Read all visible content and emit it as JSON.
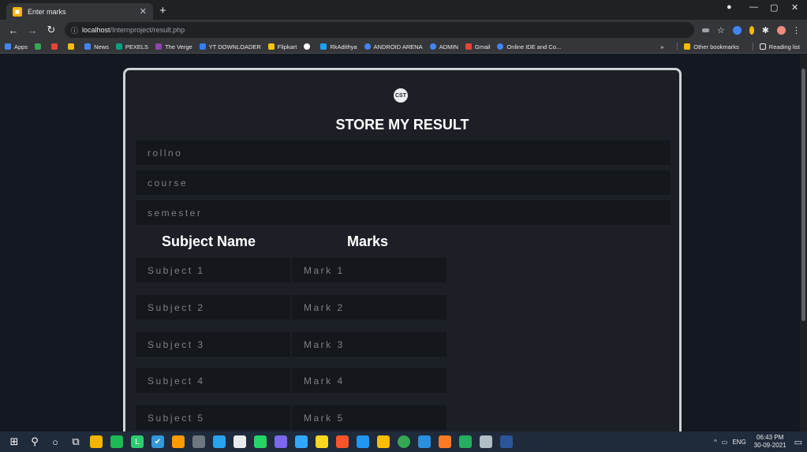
{
  "browser": {
    "tab_title": "Enter marks",
    "url_host": "localhost",
    "url_path": "/Internproject/result.php",
    "bookmarks": [
      {
        "label": "Apps",
        "color": "#4285f4"
      },
      {
        "label": "",
        "color": "#34a853"
      },
      {
        "label": "",
        "color": "#ea4335"
      },
      {
        "label": "",
        "color": "#fbbc05"
      },
      {
        "label": "News",
        "color": "#4285f4"
      },
      {
        "label": "PEXELS",
        "color": "#05a081"
      },
      {
        "label": "The Verge",
        "color": "#8e44ad"
      },
      {
        "label": "YT DOWNLOADER",
        "color": "#2f80ed"
      },
      {
        "label": "Flipkart",
        "color": "#f7c600"
      },
      {
        "label": "",
        "color": "#ffffff"
      },
      {
        "label": "RkAdithya",
        "color": "#1da1f2"
      },
      {
        "label": "ANDROID ARENA",
        "color": "#4285f4"
      },
      {
        "label": "ADMIN",
        "color": "#4285f4"
      },
      {
        "label": "Gmail",
        "color": "#ea4335"
      },
      {
        "label": "Online IDE and Co...",
        "color": "#4285f4"
      }
    ],
    "other_bookmarks": "Other bookmarks",
    "reading_list": "Reading list"
  },
  "page": {
    "logo_text": "CST",
    "title": "STORE MY RESULT",
    "fields": {
      "rollno_placeholder": "rollno",
      "course_placeholder": "course",
      "semester_placeholder": "semester"
    },
    "columns": {
      "subject": "Subject Name",
      "marks": "Marks"
    },
    "rows": [
      {
        "subject_placeholder": "Subject 1",
        "mark_placeholder": "Mark 1"
      },
      {
        "subject_placeholder": "Subject 2",
        "mark_placeholder": "Mark 2"
      },
      {
        "subject_placeholder": "Subject 3",
        "mark_placeholder": "Mark 3"
      },
      {
        "subject_placeholder": "Subject 4",
        "mark_placeholder": "Mark 4"
      },
      {
        "subject_placeholder": "Subject 5",
        "mark_placeholder": "Mark 5"
      }
    ]
  },
  "taskbar": {
    "lang": "ENG",
    "time": "06:43 PM",
    "date": "30-09-2021",
    "apps": [
      {
        "icon": "windows-icon",
        "color": "transparent",
        "glyph": "⊞"
      },
      {
        "icon": "search-icon",
        "color": "transparent",
        "glyph": "⚲"
      },
      {
        "icon": "cortana-icon",
        "color": "transparent",
        "glyph": "○"
      },
      {
        "icon": "task-view-icon",
        "color": "transparent",
        "glyph": "⧉"
      },
      {
        "icon": "file-explorer-icon",
        "color": "#f4b400",
        "glyph": ""
      },
      {
        "icon": "spotify-icon",
        "color": "#1db954",
        "glyph": ""
      },
      {
        "icon": "app-l-icon",
        "color": "#2ecc71",
        "glyph": "L"
      },
      {
        "icon": "app-check-icon",
        "color": "#3498db",
        "glyph": "✔"
      },
      {
        "icon": "illustrator-icon",
        "color": "#ff9a00",
        "glyph": ""
      },
      {
        "icon": "github-icon",
        "color": "#6e7681",
        "glyph": ""
      },
      {
        "icon": "telegram-icon",
        "color": "#2aa3ef",
        "glyph": ""
      },
      {
        "icon": "store-icon",
        "color": "#e8eaed",
        "glyph": ""
      },
      {
        "icon": "whatsapp-icon",
        "color": "#25d366",
        "glyph": ""
      },
      {
        "icon": "app-orb-icon",
        "color": "#7b68ee",
        "glyph": ""
      },
      {
        "icon": "photoshop-icon",
        "color": "#31a8ff",
        "glyph": ""
      },
      {
        "icon": "notes-icon",
        "color": "#f9d71c",
        "glyph": ""
      },
      {
        "icon": "brave-icon",
        "color": "#fb542b",
        "glyph": ""
      },
      {
        "icon": "app-blue-icon",
        "color": "#2196f3",
        "glyph": ""
      },
      {
        "icon": "drive-icon",
        "color": "#fbbc05",
        "glyph": ""
      },
      {
        "icon": "chrome-icon",
        "color": "#34a853",
        "glyph": ""
      },
      {
        "icon": "vscode-icon",
        "color": "#2b8fdf",
        "glyph": ""
      },
      {
        "icon": "xampp-icon",
        "color": "#fb7a24",
        "glyph": ""
      },
      {
        "icon": "app-green-icon",
        "color": "#27ae60",
        "glyph": ""
      },
      {
        "icon": "app-gray-icon",
        "color": "#b0bec5",
        "glyph": ""
      },
      {
        "icon": "word-icon",
        "color": "#2b579a",
        "glyph": ""
      }
    ]
  },
  "colors": {
    "page_bg": "#141820",
    "card_bg": "#1c2026",
    "card_border": "#cfd2d6",
    "input_bg": "#14171b",
    "placeholder": "#7d8186"
  }
}
